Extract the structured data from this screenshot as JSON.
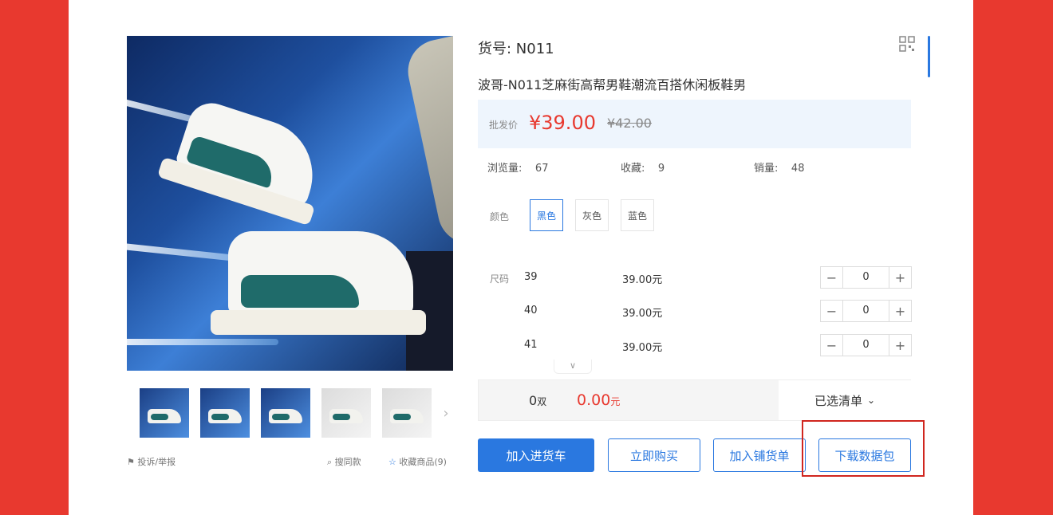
{
  "colors": {
    "accent": "#2a78e0",
    "price": "#e8392f",
    "highlight": "#d0261f",
    "background": "#e8392f"
  },
  "gallery": {
    "thumbnails_count": 5,
    "next_icon": "chevron-right-icon",
    "report_label": "投诉/举报",
    "find_similar_label": "搜同款",
    "favorite_label": "收藏商品(9)"
  },
  "product": {
    "item_code": "货号: N011",
    "title": "波哥-N011芝麻街高帮男鞋潮流百搭休闲板鞋男",
    "price_label": "批发价",
    "price": "¥39.00",
    "original_price": "¥42.00"
  },
  "stats": {
    "views_label": "浏览量:",
    "views": "67",
    "favorites_label": "收藏:",
    "favorites": "9",
    "sales_label": "销量:",
    "sales": "48"
  },
  "colors_option": {
    "label": "颜色",
    "options": [
      "黑色",
      "灰色",
      "蓝色"
    ],
    "selected": "黑色"
  },
  "sizes": {
    "label": "尺码",
    "rows": [
      {
        "size": "39",
        "price": "39.00元",
        "qty": "0"
      },
      {
        "size": "40",
        "price": "39.00元",
        "qty": "0"
      },
      {
        "size": "41",
        "price": "39.00元",
        "qty": "0"
      }
    ]
  },
  "summary": {
    "count": "0",
    "count_unit": "双",
    "total": "0.00",
    "total_unit": "元",
    "selected_list": "已选清单"
  },
  "actions": {
    "add_to_cart": "加入进货车",
    "buy_now": "立即购买",
    "add_to_shop": "加入铺货单",
    "download_package": "下载数据包"
  }
}
